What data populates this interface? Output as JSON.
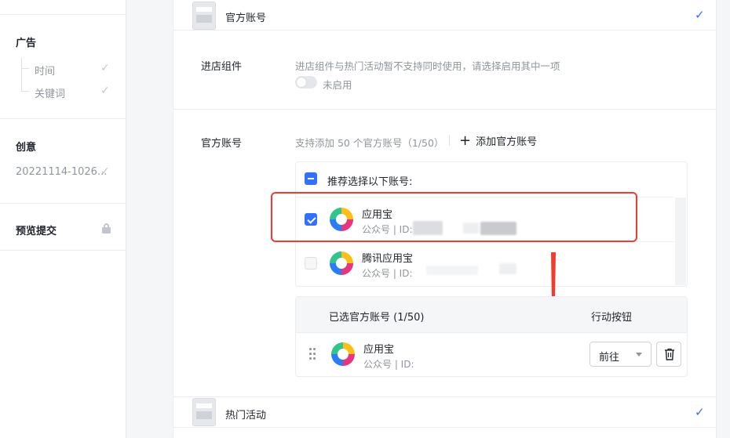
{
  "sidebar": {
    "ad_title": "广告",
    "time": "时间",
    "keywords": "关键词",
    "creative_title": "创意",
    "creative_item": "20221114-1026...",
    "preview_submit": "预览提交"
  },
  "steps": {
    "official_account": "官方账号",
    "hot_activity": "热门活动"
  },
  "store_component": {
    "label": "进店组件",
    "hint": "进店组件与热门活动暂不支持同时使用，请选择启用其中一项",
    "toggle_label": "未启用",
    "enabled": false
  },
  "official_accounts": {
    "label": "官方账号",
    "support_text": "支持添加 50 个官方账号（1/50）",
    "add_button": "添加官方账号",
    "recommend_title": "推荐选择以下账号:",
    "recommended": [
      {
        "name": "应用宝",
        "meta": "公众号 | ID:",
        "checked": true
      },
      {
        "name": "腾讯应用宝",
        "meta": "公众号 | ID:",
        "checked": false
      }
    ],
    "selected_header": "已选官方账号 (1/50)",
    "action_header": "行动按钮",
    "selected": [
      {
        "name": "应用宝",
        "meta": "公众号 | ID:",
        "action": "前往"
      }
    ]
  },
  "colors": {
    "accent": "#3370ff",
    "highlight": "#f03c2e"
  }
}
